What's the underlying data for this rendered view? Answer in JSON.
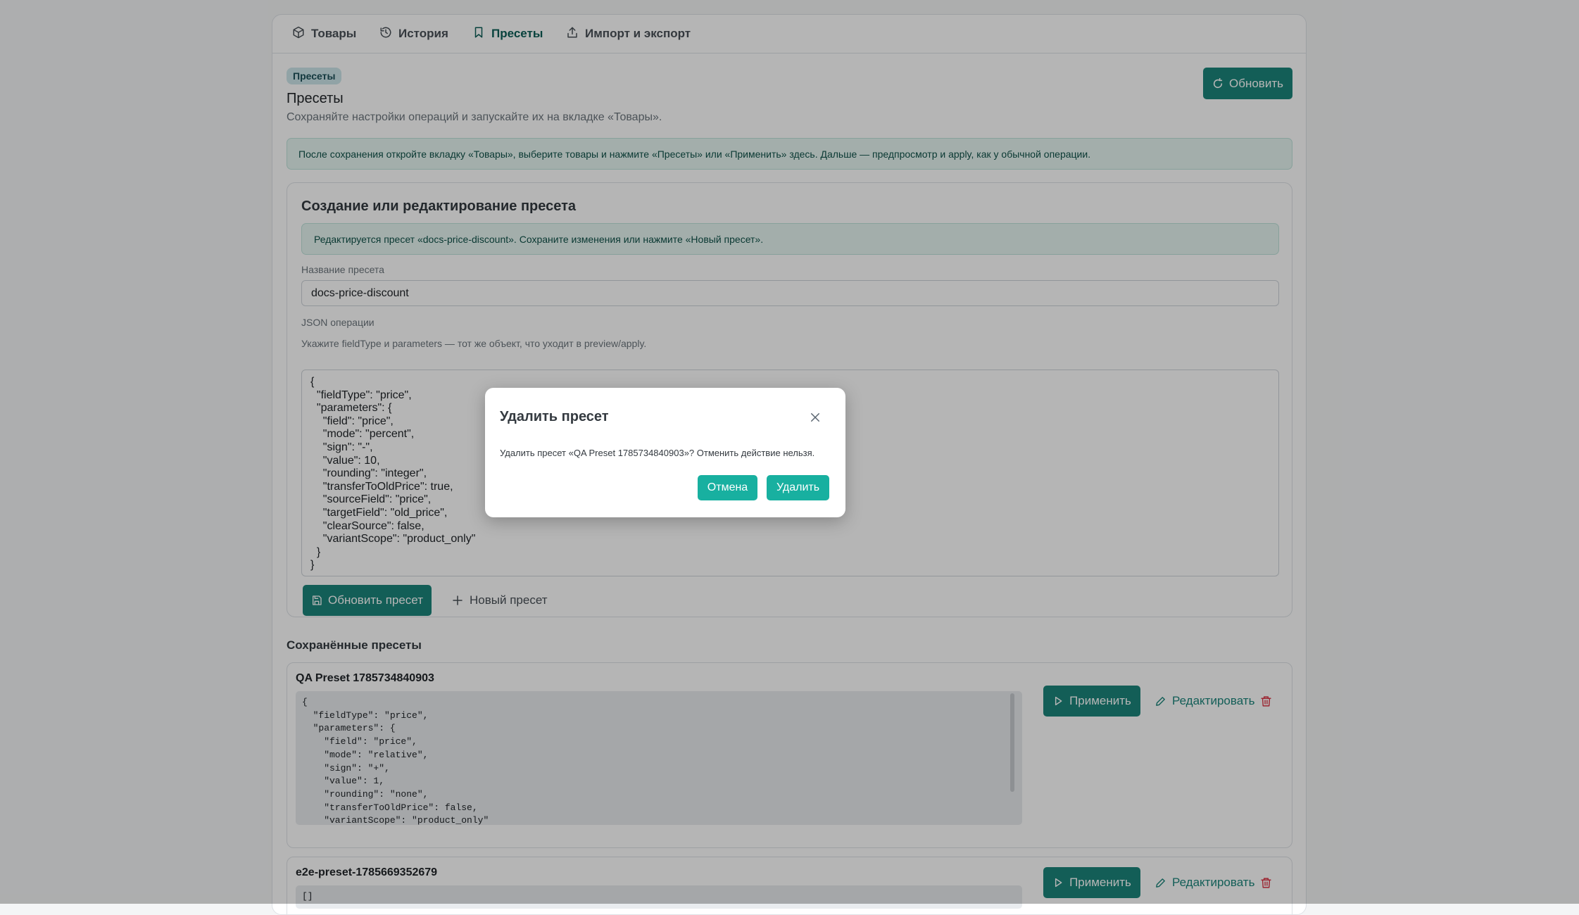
{
  "nav": {
    "tabs": [
      {
        "label": "Товары",
        "icon": "box-icon"
      },
      {
        "label": "История",
        "icon": "history-icon"
      },
      {
        "label": "Пресеты",
        "icon": "bookmark-icon",
        "active": true
      },
      {
        "label": "Импорт и экспорт",
        "icon": "upload-icon"
      }
    ]
  },
  "header": {
    "badge": "Пресеты",
    "title": "Пресеты",
    "subtitle": "Сохраняйте настройки операций и запускайте их на вкладке «Товары».",
    "refresh_label": "Обновить"
  },
  "info_alert": "После сохранения откройте вкладку «Товары», выберите товары и нажмите «Пресеты» или «Применить» здесь. Дальше — предпросмотр и apply, как у обычной операции.",
  "editor": {
    "title": "Создание или редактирование пресета",
    "editing_alert": "Редактируется пресет «docs-price-discount». Сохраните изменения или нажмите «Новый пресет».",
    "name_label": "Название пресета",
    "name_value": "docs-price-discount",
    "json_label": "JSON операции",
    "json_hint": "Укажите fieldType и parameters — тот же объект, что уходит в preview/apply.",
    "json_value": "{\n  \"fieldType\": \"price\",\n  \"parameters\": {\n    \"field\": \"price\",\n    \"mode\": \"percent\",\n    \"sign\": \"-\",\n    \"value\": 10,\n    \"rounding\": \"integer\",\n    \"transferToOldPrice\": true,\n    \"sourceField\": \"price\",\n    \"targetField\": \"old_price\",\n    \"clearSource\": false,\n    \"variantScope\": \"product_only\"\n  }\n}",
    "save_label": "Обновить пресет",
    "new_label": "Новый пресет"
  },
  "saved": {
    "heading": "Сохранённые пресеты",
    "apply_label": "Применить",
    "edit_label": "Редактировать",
    "presets": [
      {
        "name": "QA Preset 1785734840903",
        "json": "{\n  \"fieldType\": \"price\",\n  \"parameters\": {\n    \"field\": \"price\",\n    \"mode\": \"relative\",\n    \"sign\": \"+\",\n    \"value\": 1,\n    \"rounding\": \"none\",\n    \"transferToOldPrice\": false,\n    \"variantScope\": \"product_only\"\n  }\n}"
      },
      {
        "name": "e2e-preset-1785669352679",
        "json": "[]"
      }
    ]
  },
  "modal": {
    "title": "Удалить пресет",
    "text": "Удалить пресет «QA Preset 1785734840903»? Отменить действие нельзя.",
    "cancel_label": "Отмена",
    "delete_label": "Удалить"
  },
  "colors": {
    "primary": "#1b857b",
    "modal_button": "#18b0a0",
    "danger": "#dc3545"
  }
}
